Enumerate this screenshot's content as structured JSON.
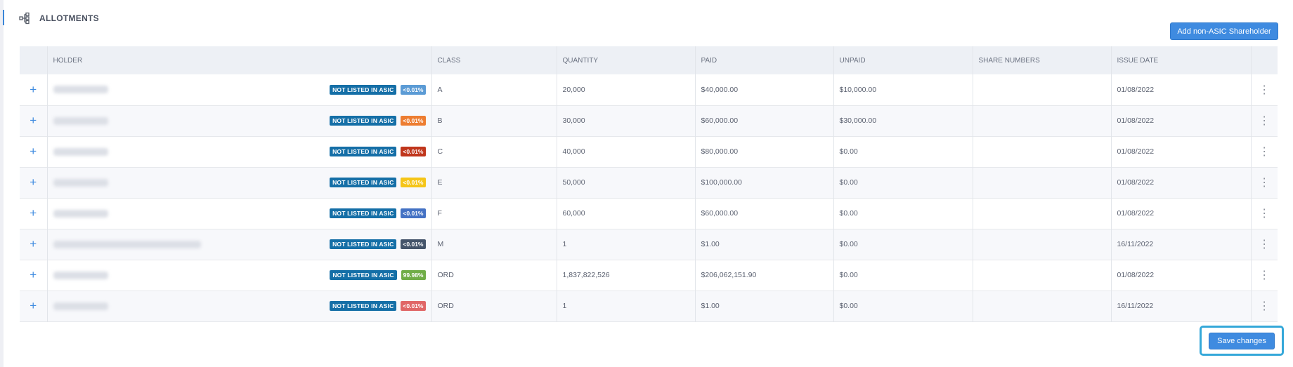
{
  "section": {
    "title": "ALLOTMENTS",
    "icon": "hierarchy-icon"
  },
  "actions": {
    "add_label": "Add non-ASIC Shareholder",
    "save_label": "Save changes"
  },
  "table": {
    "columns": [
      "",
      "HOLDER",
      "CLASS",
      "QUANTITY",
      "PAID",
      "UNPAID",
      "SHARE NUMBERS",
      "ISSUE DATE",
      ""
    ],
    "rows": [
      {
        "asic": "NOT LISTED IN ASIC",
        "pct": "<0.01%",
        "pct_color": "#5b9bd5",
        "class": "A",
        "quantity": "20,000",
        "paid": "$40,000.00",
        "unpaid": "$10,000.00",
        "share_numbers": "",
        "issue_date": "01/08/2022",
        "name_width": 78
      },
      {
        "asic": "NOT LISTED IN ASIC",
        "pct": "<0.01%",
        "pct_color": "#ed7d31",
        "class": "B",
        "quantity": "30,000",
        "paid": "$60,000.00",
        "unpaid": "$30,000.00",
        "share_numbers": "",
        "issue_date": "01/08/2022",
        "name_width": 78
      },
      {
        "asic": "NOT LISTED IN ASIC",
        "pct": "<0.01%",
        "pct_color": "#c0361c",
        "class": "C",
        "quantity": "40,000",
        "paid": "$80,000.00",
        "unpaid": "$0.00",
        "share_numbers": "",
        "issue_date": "01/08/2022",
        "name_width": 78
      },
      {
        "asic": "NOT LISTED IN ASIC",
        "pct": "<0.01%",
        "pct_color": "#f5c518",
        "class": "E",
        "quantity": "50,000",
        "paid": "$100,000.00",
        "unpaid": "$0.00",
        "share_numbers": "",
        "issue_date": "01/08/2022",
        "name_width": 78
      },
      {
        "asic": "NOT LISTED IN ASIC",
        "pct": "<0.01%",
        "pct_color": "#4472c4",
        "class": "F",
        "quantity": "60,000",
        "paid": "$60,000.00",
        "unpaid": "$0.00",
        "share_numbers": "",
        "issue_date": "01/08/2022",
        "name_width": 78
      },
      {
        "asic": "NOT LISTED IN ASIC",
        "pct": "<0.01%",
        "pct_color": "#44546a",
        "class": "M",
        "quantity": "1",
        "paid": "$1.00",
        "unpaid": "$0.00",
        "share_numbers": "",
        "issue_date": "16/11/2022",
        "name_width": 210
      },
      {
        "asic": "NOT LISTED IN ASIC",
        "pct": "99.98%",
        "pct_color": "#70ad47",
        "class": "ORD",
        "quantity": "1,837,822,526",
        "paid": "$206,062,151.90",
        "unpaid": "$0.00",
        "share_numbers": "",
        "issue_date": "01/08/2022",
        "name_width": 78
      },
      {
        "asic": "NOT LISTED IN ASIC",
        "pct": "<0.01%",
        "pct_color": "#e06666",
        "class": "ORD",
        "quantity": "1",
        "paid": "$1.00",
        "unpaid": "$0.00",
        "share_numbers": "",
        "issue_date": "16/11/2022",
        "name_width": 78
      }
    ]
  },
  "icons": {
    "expand": "plus-icon",
    "row_menu": "kebab-menu-icon"
  }
}
